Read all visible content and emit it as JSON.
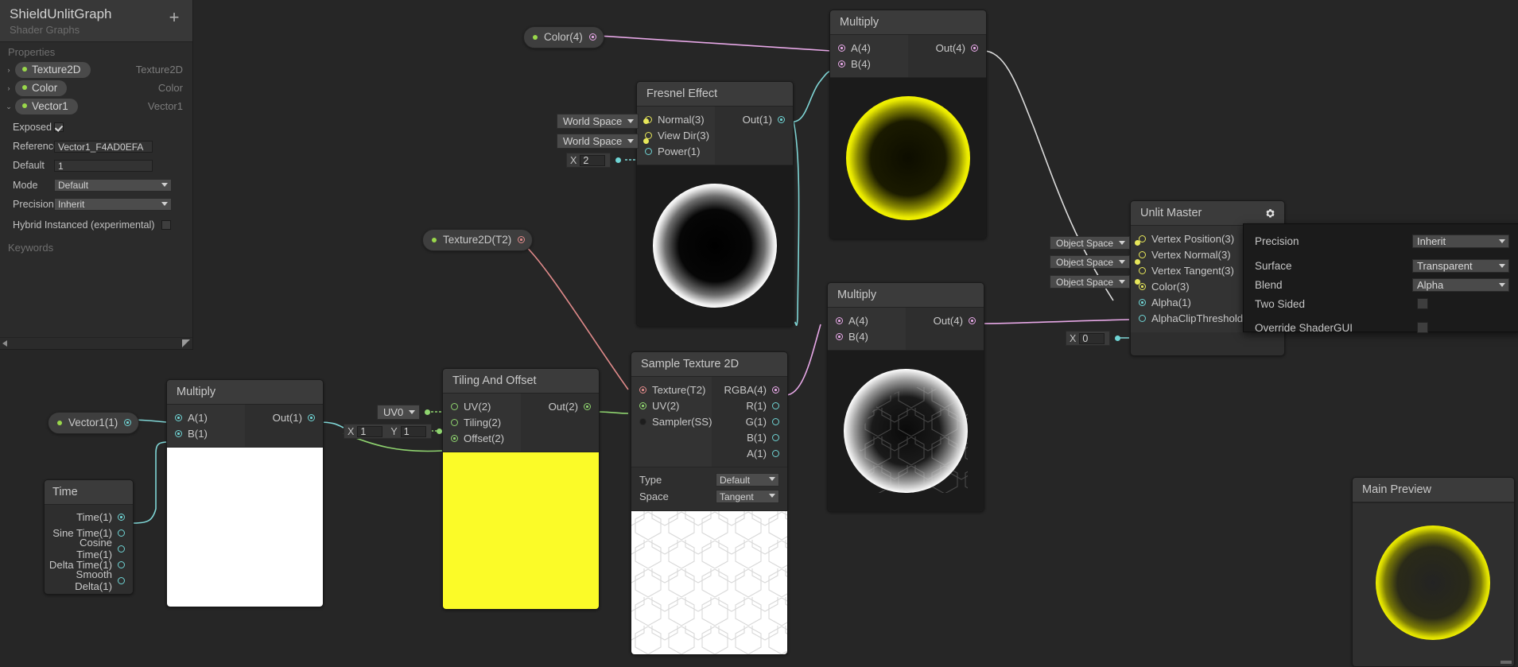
{
  "blackboard": {
    "title": "ShieldUnlitGraph",
    "subtitle": "Shader Graphs",
    "add_label": "+",
    "sections": {
      "properties": "Properties",
      "keywords": "Keywords"
    },
    "properties": [
      {
        "name": "Texture2D",
        "type": "Texture2D",
        "expanded": false,
        "chevron": "›"
      },
      {
        "name": "Color",
        "type": "Color",
        "expanded": false,
        "chevron": "›"
      },
      {
        "name": "Vector1",
        "type": "Vector1",
        "expanded": true,
        "chevron": "⌄"
      }
    ],
    "vector1_fields": {
      "exposed_label": "Exposed",
      "exposed_checked": true,
      "reference_label": "Reference",
      "reference_value": "Vector1_F4AD0EFA",
      "default_label": "Default",
      "default_value": "1",
      "mode_label": "Mode",
      "mode_value": "Default",
      "precision_label": "Precision",
      "precision_value": "Inherit",
      "hybrid_label": "Hybrid Instanced (experimental)",
      "hybrid_checked": false
    }
  },
  "property_nodes": {
    "color4": "Color(4)",
    "texture2d": "Texture2D(T2)",
    "vector1": "Vector1(1)"
  },
  "nodes": {
    "multiply_top": {
      "title": "Multiply",
      "inputs": [
        "A(4)",
        "B(4)"
      ],
      "outputs": [
        "Out(4)"
      ]
    },
    "multiply_bottom": {
      "title": "Multiply",
      "inputs": [
        "A(4)",
        "B(4)"
      ],
      "outputs": [
        "Out(4)"
      ]
    },
    "multiply_left": {
      "title": "Multiply",
      "inputs": [
        "A(1)",
        "B(1)"
      ],
      "outputs": [
        "Out(1)"
      ]
    },
    "fresnel": {
      "title": "Fresnel Effect",
      "inputs": [
        "Normal(3)",
        "View Dir(3)",
        "Power(1)"
      ],
      "outputs": [
        "Out(1)"
      ],
      "input_widgets": {
        "normal_space": "World Space",
        "viewdir_space": "World Space",
        "power_axis": "X",
        "power_value": "2"
      }
    },
    "tiling_offset": {
      "title": "Tiling And Offset",
      "inputs": [
        "UV(2)",
        "Tiling(2)",
        "Offset(2)"
      ],
      "outputs": [
        "Out(2)"
      ],
      "input_widgets": {
        "uv_channel": "UV0",
        "tiling_x_label": "X",
        "tiling_x": "1",
        "tiling_y_label": "Y",
        "tiling_y": "1"
      }
    },
    "sample_texture": {
      "title": "Sample Texture 2D",
      "inputs": [
        "Texture(T2)",
        "UV(2)",
        "Sampler(SS)"
      ],
      "outputs": [
        "RGBA(4)",
        "R(1)",
        "G(1)",
        "B(1)",
        "A(1)"
      ],
      "settings": [
        {
          "label": "Type",
          "value": "Default"
        },
        {
          "label": "Space",
          "value": "Tangent"
        }
      ]
    },
    "time": {
      "title": "Time",
      "outputs": [
        "Time(1)",
        "Sine Time(1)",
        "Cosine Time(1)",
        "Delta Time(1)",
        "Smooth Delta(1)"
      ]
    },
    "unlit_master": {
      "title": "Unlit Master",
      "gear_icon": "gear-icon",
      "inputs": [
        "Vertex Position(3)",
        "Vertex Normal(3)",
        "Vertex Tangent(3)",
        "Color(3)",
        "Alpha(1)",
        "AlphaClipThreshold(1)"
      ],
      "input_widgets": {
        "vertex_position_space": "Object Space",
        "vertex_normal_space": "Object Space",
        "vertex_tangent_space": "Object Space",
        "alpha_clip_axis": "X",
        "alpha_clip_value": "0"
      }
    },
    "main_preview": {
      "title": "Main Preview"
    }
  },
  "settings_popup": {
    "rows": [
      {
        "label": "Precision",
        "type": "dropdown",
        "value": "Inherit"
      },
      {
        "label": "Surface",
        "type": "dropdown",
        "value": "Transparent"
      },
      {
        "label": "Blend",
        "type": "dropdown",
        "value": "Alpha"
      },
      {
        "label": "Two Sided",
        "type": "checkbox",
        "checked": false
      },
      {
        "label": "Override ShaderGUI",
        "type": "checkbox",
        "checked": false
      }
    ]
  },
  "colors": {
    "background": "#262626",
    "node_body": "#2e2e2e",
    "node_header": "#3b3b3b",
    "vector3_port": "#e7e75a",
    "vector4_port": "#e7a8e7",
    "float_port": "#6fd4d4",
    "vector2_port": "#8fd46f",
    "texture_port": "#e08a8a",
    "property_dot": "#9ad84b",
    "shield_yellow": "#e8e800"
  }
}
